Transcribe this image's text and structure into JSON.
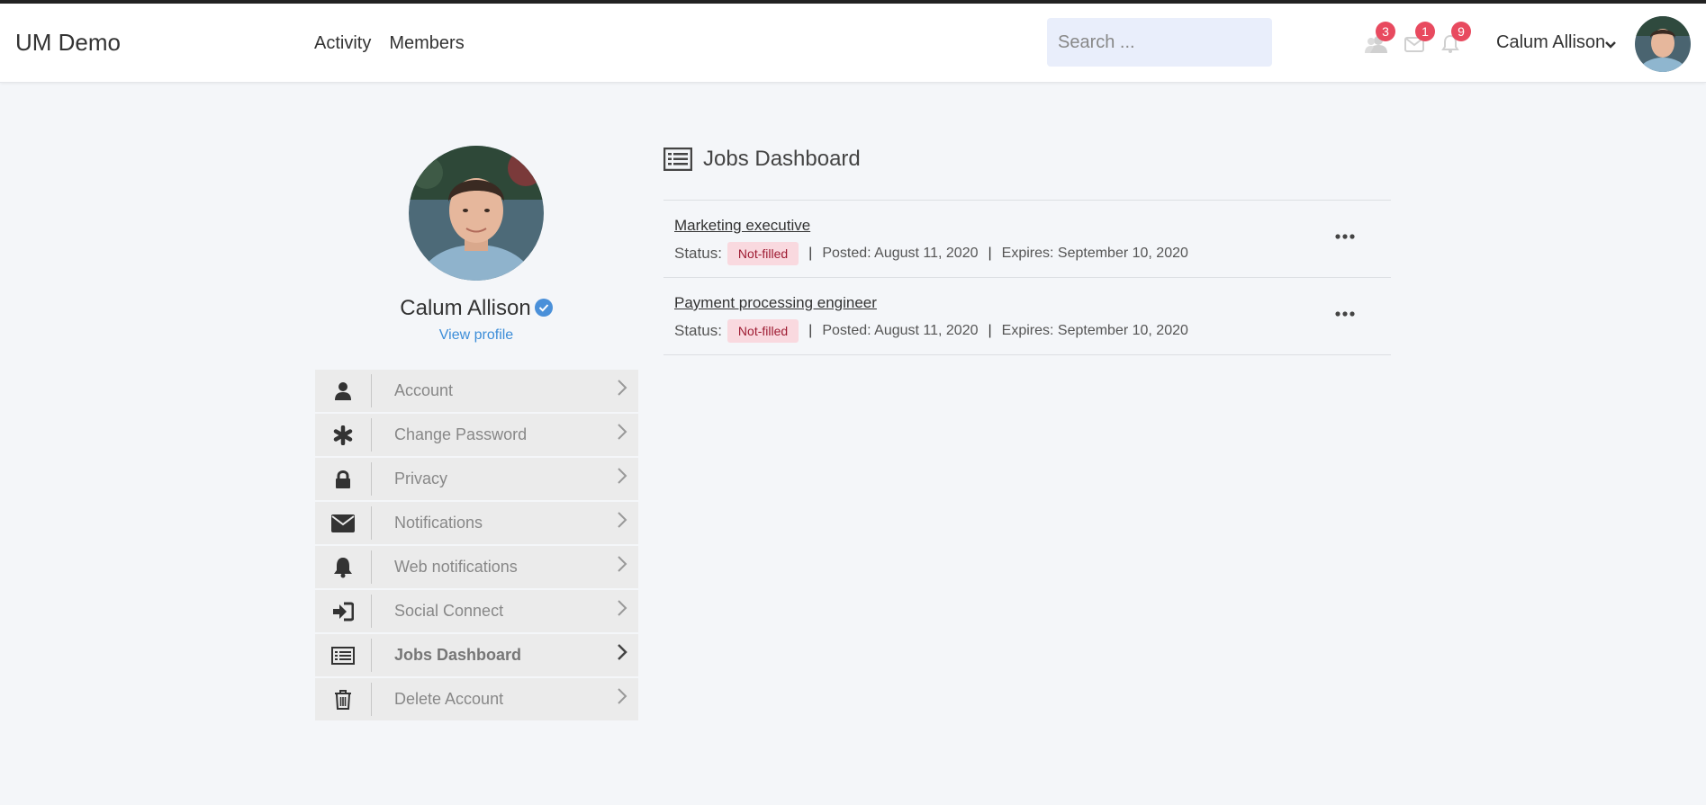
{
  "header": {
    "brand": "UM Demo",
    "nav": [
      "Activity",
      "Members"
    ],
    "search_placeholder": "Search ...",
    "badges": {
      "friends": "3",
      "messages": "1",
      "notifications": "9"
    },
    "user_name": "Calum Allison"
  },
  "profile": {
    "name": "Calum Allison",
    "view_profile": "View profile"
  },
  "menu": {
    "items": [
      {
        "label": "Account",
        "icon": "user-icon"
      },
      {
        "label": "Change Password",
        "icon": "asterisk-icon"
      },
      {
        "label": "Privacy",
        "icon": "lock-icon"
      },
      {
        "label": "Notifications",
        "icon": "envelope-icon"
      },
      {
        "label": "Web notifications",
        "icon": "bell-icon"
      },
      {
        "label": "Social Connect",
        "icon": "sign-in-icon"
      },
      {
        "label": "Jobs Dashboard",
        "icon": "list-icon",
        "active": true
      },
      {
        "label": "Delete Account",
        "icon": "trash-icon"
      }
    ]
  },
  "main": {
    "title": "Jobs Dashboard",
    "jobs": [
      {
        "title": "Marketing executive",
        "status_label": "Status:",
        "status": "Not-filled",
        "posted": "Posted: August 11, 2020",
        "expires": "Expires: September 10, 2020"
      },
      {
        "title": "Payment processing engineer",
        "status_label": "Status:",
        "status": "Not-filled",
        "posted": "Posted: August 11, 2020",
        "expires": "Expires: September 10, 2020"
      }
    ]
  },
  "colors": {
    "accent": "#3c8dd8",
    "badge": "#e84a5f",
    "status_pill_bg": "#f9d9df",
    "status_pill_text": "#9e1b32"
  }
}
